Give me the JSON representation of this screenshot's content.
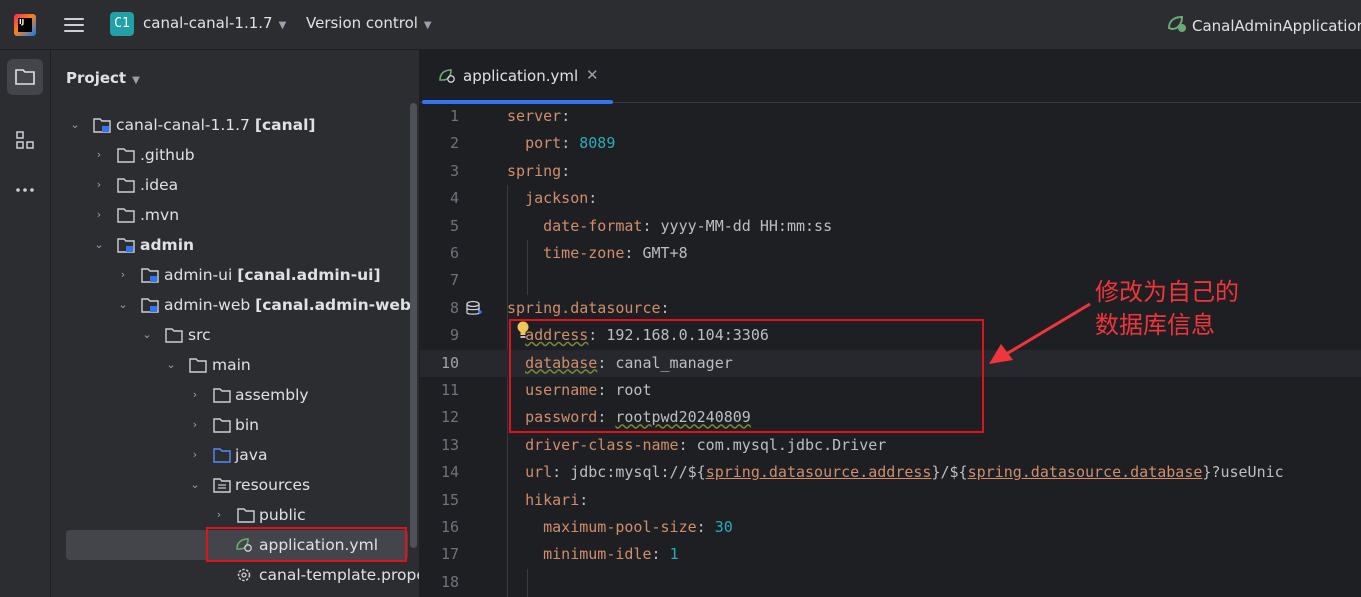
{
  "titlebar": {
    "logo_text": "IJ",
    "project_badge": "C1",
    "project_name": "canal-canal-1.1.7",
    "vcs_label": "Version control",
    "run_config": "CanalAdminApplication"
  },
  "project_panel": {
    "title": "Project",
    "tree": [
      {
        "label": "canal-canal-1.1.7",
        "module": "[canal]",
        "icon": "module-folder-icon"
      },
      {
        "label": ".github",
        "icon": "folder-icon"
      },
      {
        "label": ".idea",
        "icon": "folder-icon"
      },
      {
        "label": ".mvn",
        "icon": "folder-icon"
      },
      {
        "label": "admin",
        "icon": "module-folder-icon"
      },
      {
        "label": "admin-ui",
        "module": "[canal.admin-ui]",
        "icon": "module-folder-icon"
      },
      {
        "label": "admin-web",
        "module": "[canal.admin-web]",
        "icon": "module-folder-icon"
      },
      {
        "label": "src",
        "icon": "folder-icon"
      },
      {
        "label": "main",
        "icon": "folder-icon"
      },
      {
        "label": "assembly",
        "icon": "folder-icon"
      },
      {
        "label": "bin",
        "icon": "folder-icon"
      },
      {
        "label": "java",
        "icon": "source-folder-icon"
      },
      {
        "label": "resources",
        "icon": "resources-folder-icon"
      },
      {
        "label": "public",
        "icon": "folder-icon"
      },
      {
        "label": "application.yml",
        "icon": "spring-yaml-icon"
      },
      {
        "label": "canal-template.proper",
        "icon": "properties-gear-icon"
      }
    ]
  },
  "editor": {
    "tab_label": "application.yml",
    "tab_close": "✕",
    "line_numbers": [
      "1",
      "2",
      "3",
      "4",
      "5",
      "6",
      "7",
      "8",
      "9",
      "10",
      "11",
      "12",
      "13",
      "14",
      "15",
      "16",
      "17",
      "18"
    ],
    "code": {
      "server": "server",
      "port_key": "port",
      "port_val": "8089",
      "spring": "spring",
      "jackson": "jackson",
      "date_format_key": "date-format",
      "date_format_val": "yyyy-MM-dd HH:mm:ss",
      "time_zone_key": "time-zone",
      "time_zone_val": "GMT+8",
      "datasource": "spring.datasource",
      "address_key": "address",
      "address_val": "192.168.0.104:3306",
      "database_key": "database",
      "database_val": "canal_manager",
      "username_key": "username",
      "username_val": "root",
      "password_key": "password",
      "password_val": "rootpwd20240809",
      "driver_key": "driver-class-name",
      "driver_val": "com.mysql.jdbc.Driver",
      "url_key": "url",
      "url_prefix": "jdbc:mysql://${",
      "url_ref1": "spring.datasource.address",
      "url_mid": "}/${",
      "url_ref2": "spring.datasource.database",
      "url_suffix": "}?useUnic",
      "hikari": "hikari",
      "max_pool_key": "maximum-pool-size",
      "max_pool_val": "30",
      "min_idle_key": "minimum-idle",
      "min_idle_val": "1"
    }
  },
  "annotation": {
    "line1": "修改为自己的",
    "line2": "数据库信息",
    "color": "#f0353c"
  }
}
